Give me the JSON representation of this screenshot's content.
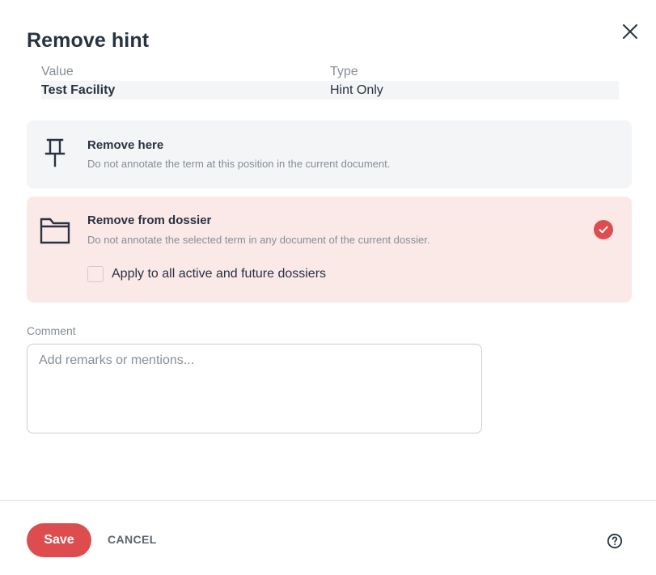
{
  "dialog": {
    "title": "Remove hint",
    "close_icon": "close-icon"
  },
  "info_table": {
    "headers": {
      "value": "Value",
      "type": "Type"
    },
    "row": {
      "value": "Test Facility",
      "type": "Hint Only"
    }
  },
  "options": {
    "remove_here": {
      "icon": "pin-icon",
      "title": "Remove here",
      "description": "Do not annotate the term at this position in the current document.",
      "selected": false
    },
    "remove_from_dossier": {
      "icon": "folder-icon",
      "title": "Remove from dossier",
      "description": "Do not annotate the selected term in any document of the current dossier.",
      "selected": true,
      "apply_all_label": "Apply to all active and future dossiers",
      "apply_all_checked": false
    }
  },
  "comment": {
    "label": "Comment",
    "placeholder": "Add remarks or mentions...",
    "value": ""
  },
  "footer": {
    "save_label": "Save",
    "cancel_label": "CANCEL",
    "help_icon": "help-circle-icon"
  },
  "colors": {
    "accent": "#dd4d50",
    "selected_bg": "#fbe9e8",
    "option_bg": "#f4f5f7",
    "text": "#283241",
    "muted": "#868e96"
  }
}
